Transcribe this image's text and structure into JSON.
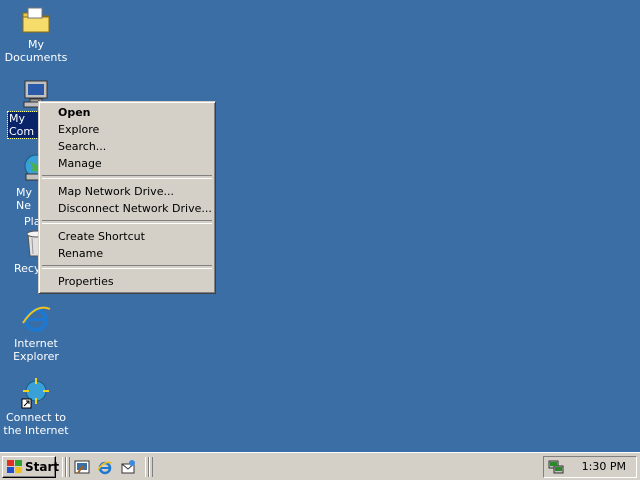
{
  "desktop": {
    "icons": [
      {
        "label": "My Documents"
      },
      {
        "label": "My Computer",
        "label_visible": "My Com"
      },
      {
        "label_line1": "My Ne",
        "label_line2": "Plac"
      },
      {
        "label": "Recyc"
      },
      {
        "label_line1": "Internet",
        "label_line2": "Explorer"
      },
      {
        "label_line1": "Connect to",
        "label_line2": "the Internet"
      }
    ]
  },
  "context_menu": {
    "groups": [
      [
        "Open",
        "Explore",
        "Search...",
        "Manage"
      ],
      [
        "Map Network Drive...",
        "Disconnect Network Drive..."
      ],
      [
        "Create Shortcut",
        "Rename"
      ],
      [
        "Properties"
      ]
    ],
    "default_item": "Open"
  },
  "taskbar": {
    "start_label": "Start",
    "quick_launch": [
      "show-desktop-icon",
      "internet-explorer-icon",
      "outlook-express-icon"
    ],
    "tray": {
      "clock": "1:30 PM",
      "icons": [
        "network-connection-icon"
      ]
    }
  },
  "colors": {
    "desktop": "#3a6ea5",
    "face": "#d4d0c8",
    "selection": "#0a246a"
  }
}
